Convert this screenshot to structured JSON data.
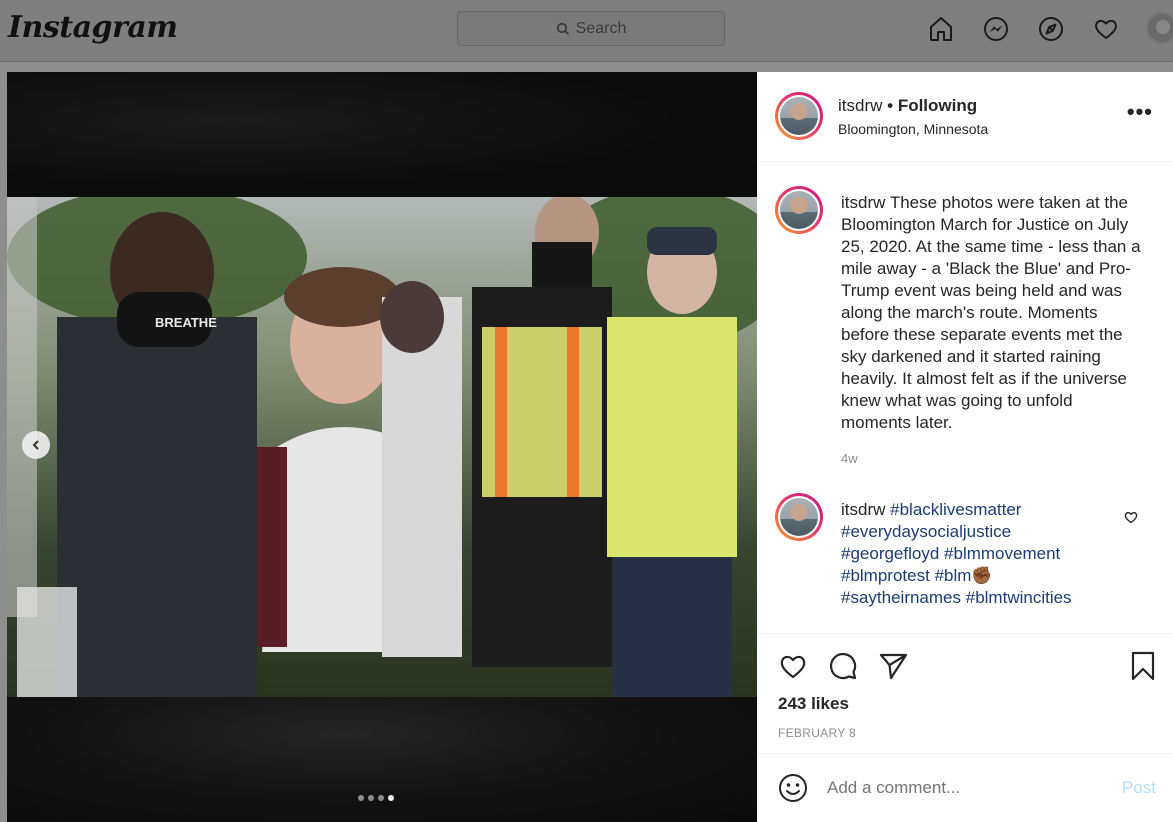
{
  "header": {
    "logo": "Instagram",
    "search_placeholder": "Search",
    "nav_icons": [
      "home-icon",
      "messenger-icon",
      "explore-icon",
      "heart-icon",
      "profile-avatar"
    ]
  },
  "post": {
    "username": "itsdrw",
    "follow_state": "• Following",
    "location": "Bloomington, Minnesota",
    "more_label": "•••",
    "carousel": {
      "current": 4,
      "total": 4
    },
    "photo_alt": "Protesters marching; one mask reads BREATHE"
  },
  "comments": [
    {
      "username": "itsdrw",
      "text": " These photos were taken at the Bloomington March for Justice on July 25, 2020. At the same time - less than a mile away - a 'Black the Blue' and Pro-Trump event was being held and was along the march's route. Moments before these separate events met the sky darkened and it started raining heavily. It almost felt as if the universe knew what was going to unfold moments later.",
      "time": "4w"
    },
    {
      "username": "itsdrw",
      "hashtags": [
        "#blacklivesmatter",
        "#everydaysocialjustice",
        "#georgefloyd",
        "#blmmovement",
        "#blmprotest",
        "#blm✊🏾",
        "#saytheirnames",
        "#blmtwincities"
      ]
    }
  ],
  "actions": {
    "likes": "243 likes",
    "date": "FEBRUARY 8"
  },
  "comment_box": {
    "placeholder": "Add a comment...",
    "post_label": "Post"
  },
  "colors": {
    "hashtag": "#1e3c72",
    "post_disabled": "#b2dffc",
    "muted": "#8e8e8e"
  }
}
